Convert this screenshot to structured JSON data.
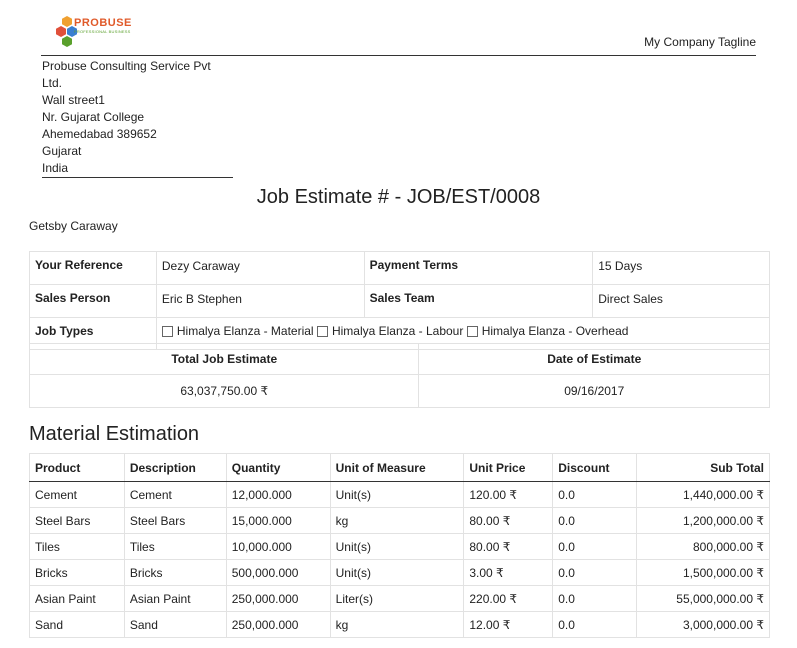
{
  "company": {
    "logo_text": "PROBUSE",
    "logo_subtext": "PROFESSIONAL BUSINESS",
    "tagline": "My Company Tagline",
    "address_lines": [
      "Probuse Consulting Service Pvt Ltd.",
      "Wall street1",
      "Nr. Gujarat College",
      "Ahemedabad 389652",
      "Gujarat",
      "India"
    ]
  },
  "document": {
    "title": "Job Estimate # - JOB/EST/0008",
    "customer": "Getsby Caraway"
  },
  "info": {
    "your_reference_label": "Your Reference",
    "your_reference_value": "Dezy Caraway",
    "payment_terms_label": "Payment Terms",
    "payment_terms_value": "15 Days",
    "sales_person_label": "Sales Person",
    "sales_person_value": "Eric B Stephen",
    "sales_team_label": "Sales Team",
    "sales_team_value": "Direct Sales",
    "job_types_label": "Job Types",
    "job_types": [
      "Himalya Elanza - Material",
      "Himalya Elanza - Labour",
      "Himalya Elanza - Overhead"
    ]
  },
  "summary": {
    "total_label": "Total Job Estimate",
    "total_value": "63,037,750.00 ₹",
    "date_label": "Date of Estimate",
    "date_value": "09/16/2017"
  },
  "material": {
    "section_title": "Material Estimation",
    "headers": [
      "Product",
      "Description",
      "Quantity",
      "Unit of Measure",
      "Unit Price",
      "Discount",
      "Sub Total"
    ],
    "rows": [
      [
        "Cement",
        "Cement",
        "12,000.000",
        "Unit(s)",
        "120.00 ₹",
        "0.0",
        "1,440,000.00 ₹"
      ],
      [
        "Steel Bars",
        "Steel Bars",
        "15,000.000",
        "kg",
        "80.00 ₹",
        "0.0",
        "1,200,000.00 ₹"
      ],
      [
        "Tiles",
        "Tiles",
        "10,000.000",
        "Unit(s)",
        "80.00 ₹",
        "0.0",
        "800,000.00 ₹"
      ],
      [
        "Bricks",
        "Bricks",
        "500,000.000",
        "Unit(s)",
        "3.00 ₹",
        "0.0",
        "1,500,000.00 ₹"
      ],
      [
        "Asian Paint",
        "Asian Paint",
        "250,000.000",
        "Liter(s)",
        "220.00 ₹",
        "0.0",
        "55,000,000.00 ₹"
      ],
      [
        "Sand",
        "Sand",
        "250,000.000",
        "kg",
        "12.00 ₹",
        "0.0",
        "3,000,000.00 ₹"
      ]
    ]
  }
}
